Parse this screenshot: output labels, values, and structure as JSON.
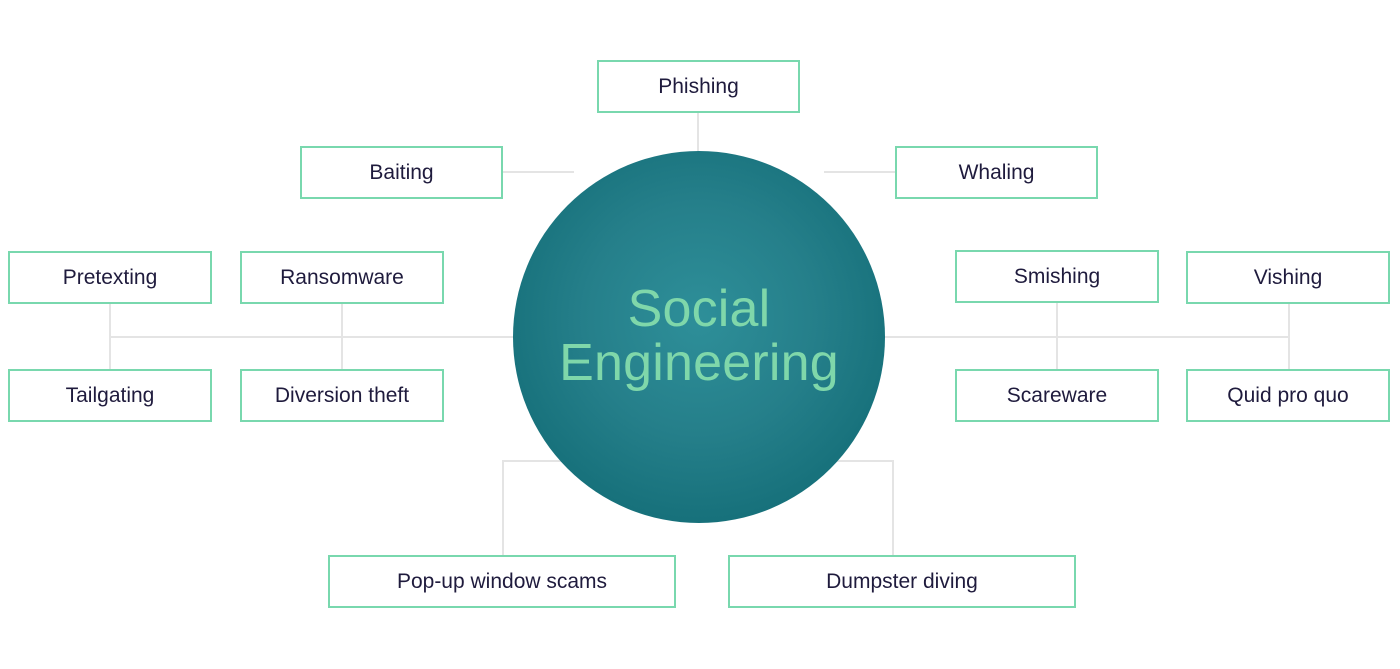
{
  "diagram": {
    "title": "Social Engineering",
    "center": {
      "line1": "Social",
      "line2": "Engineering",
      "text": "Social\nEngineering"
    },
    "colors": {
      "hub_center": "#2e8f99",
      "hub_edge": "#0e6871",
      "hub_text": "#7fd7aa",
      "node_border": "#79d8ae",
      "node_text": "#1f1b3d",
      "connector": "#e4e4e4",
      "background": "#ffffff"
    },
    "nodes": [
      {
        "id": "phishing",
        "label": "Phishing"
      },
      {
        "id": "baiting",
        "label": "Baiting"
      },
      {
        "id": "whaling",
        "label": "Whaling"
      },
      {
        "id": "pretexting",
        "label": "Pretexting"
      },
      {
        "id": "ransomware",
        "label": "Ransomware"
      },
      {
        "id": "smishing",
        "label": "Smishing"
      },
      {
        "id": "vishing",
        "label": "Vishing"
      },
      {
        "id": "tailgating",
        "label": "Tailgating"
      },
      {
        "id": "diversion-theft",
        "label": "Diversion theft"
      },
      {
        "id": "scareware",
        "label": "Scareware"
      },
      {
        "id": "quid-pro-quo",
        "label": "Quid pro quo"
      },
      {
        "id": "popup-window-scams",
        "label": "Pop-up window scams"
      },
      {
        "id": "dumpster-diving",
        "label": "Dumpster diving"
      }
    ]
  },
  "chart_data": {
    "type": "diagram",
    "subtype": "hub-and-spoke",
    "title": "Social Engineering",
    "center_node": "Social Engineering",
    "categories": [
      "Phishing",
      "Baiting",
      "Whaling",
      "Pretexting",
      "Ransomware",
      "Smishing",
      "Vishing",
      "Tailgating",
      "Diversion theft",
      "Scareware",
      "Quid pro quo",
      "Pop-up window scams",
      "Dumpster diving"
    ],
    "edges": [
      [
        "Social Engineering",
        "Phishing"
      ],
      [
        "Social Engineering",
        "Baiting"
      ],
      [
        "Social Engineering",
        "Whaling"
      ],
      [
        "Social Engineering",
        "Pretexting"
      ],
      [
        "Social Engineering",
        "Ransomware"
      ],
      [
        "Social Engineering",
        "Smishing"
      ],
      [
        "Social Engineering",
        "Vishing"
      ],
      [
        "Social Engineering",
        "Tailgating"
      ],
      [
        "Social Engineering",
        "Diversion theft"
      ],
      [
        "Social Engineering",
        "Scareware"
      ],
      [
        "Social Engineering",
        "Quid pro quo"
      ],
      [
        "Social Engineering",
        "Pop-up window scams"
      ],
      [
        "Social Engineering",
        "Dumpster diving"
      ]
    ],
    "legend": [],
    "xlabel": "",
    "ylabel": ""
  }
}
